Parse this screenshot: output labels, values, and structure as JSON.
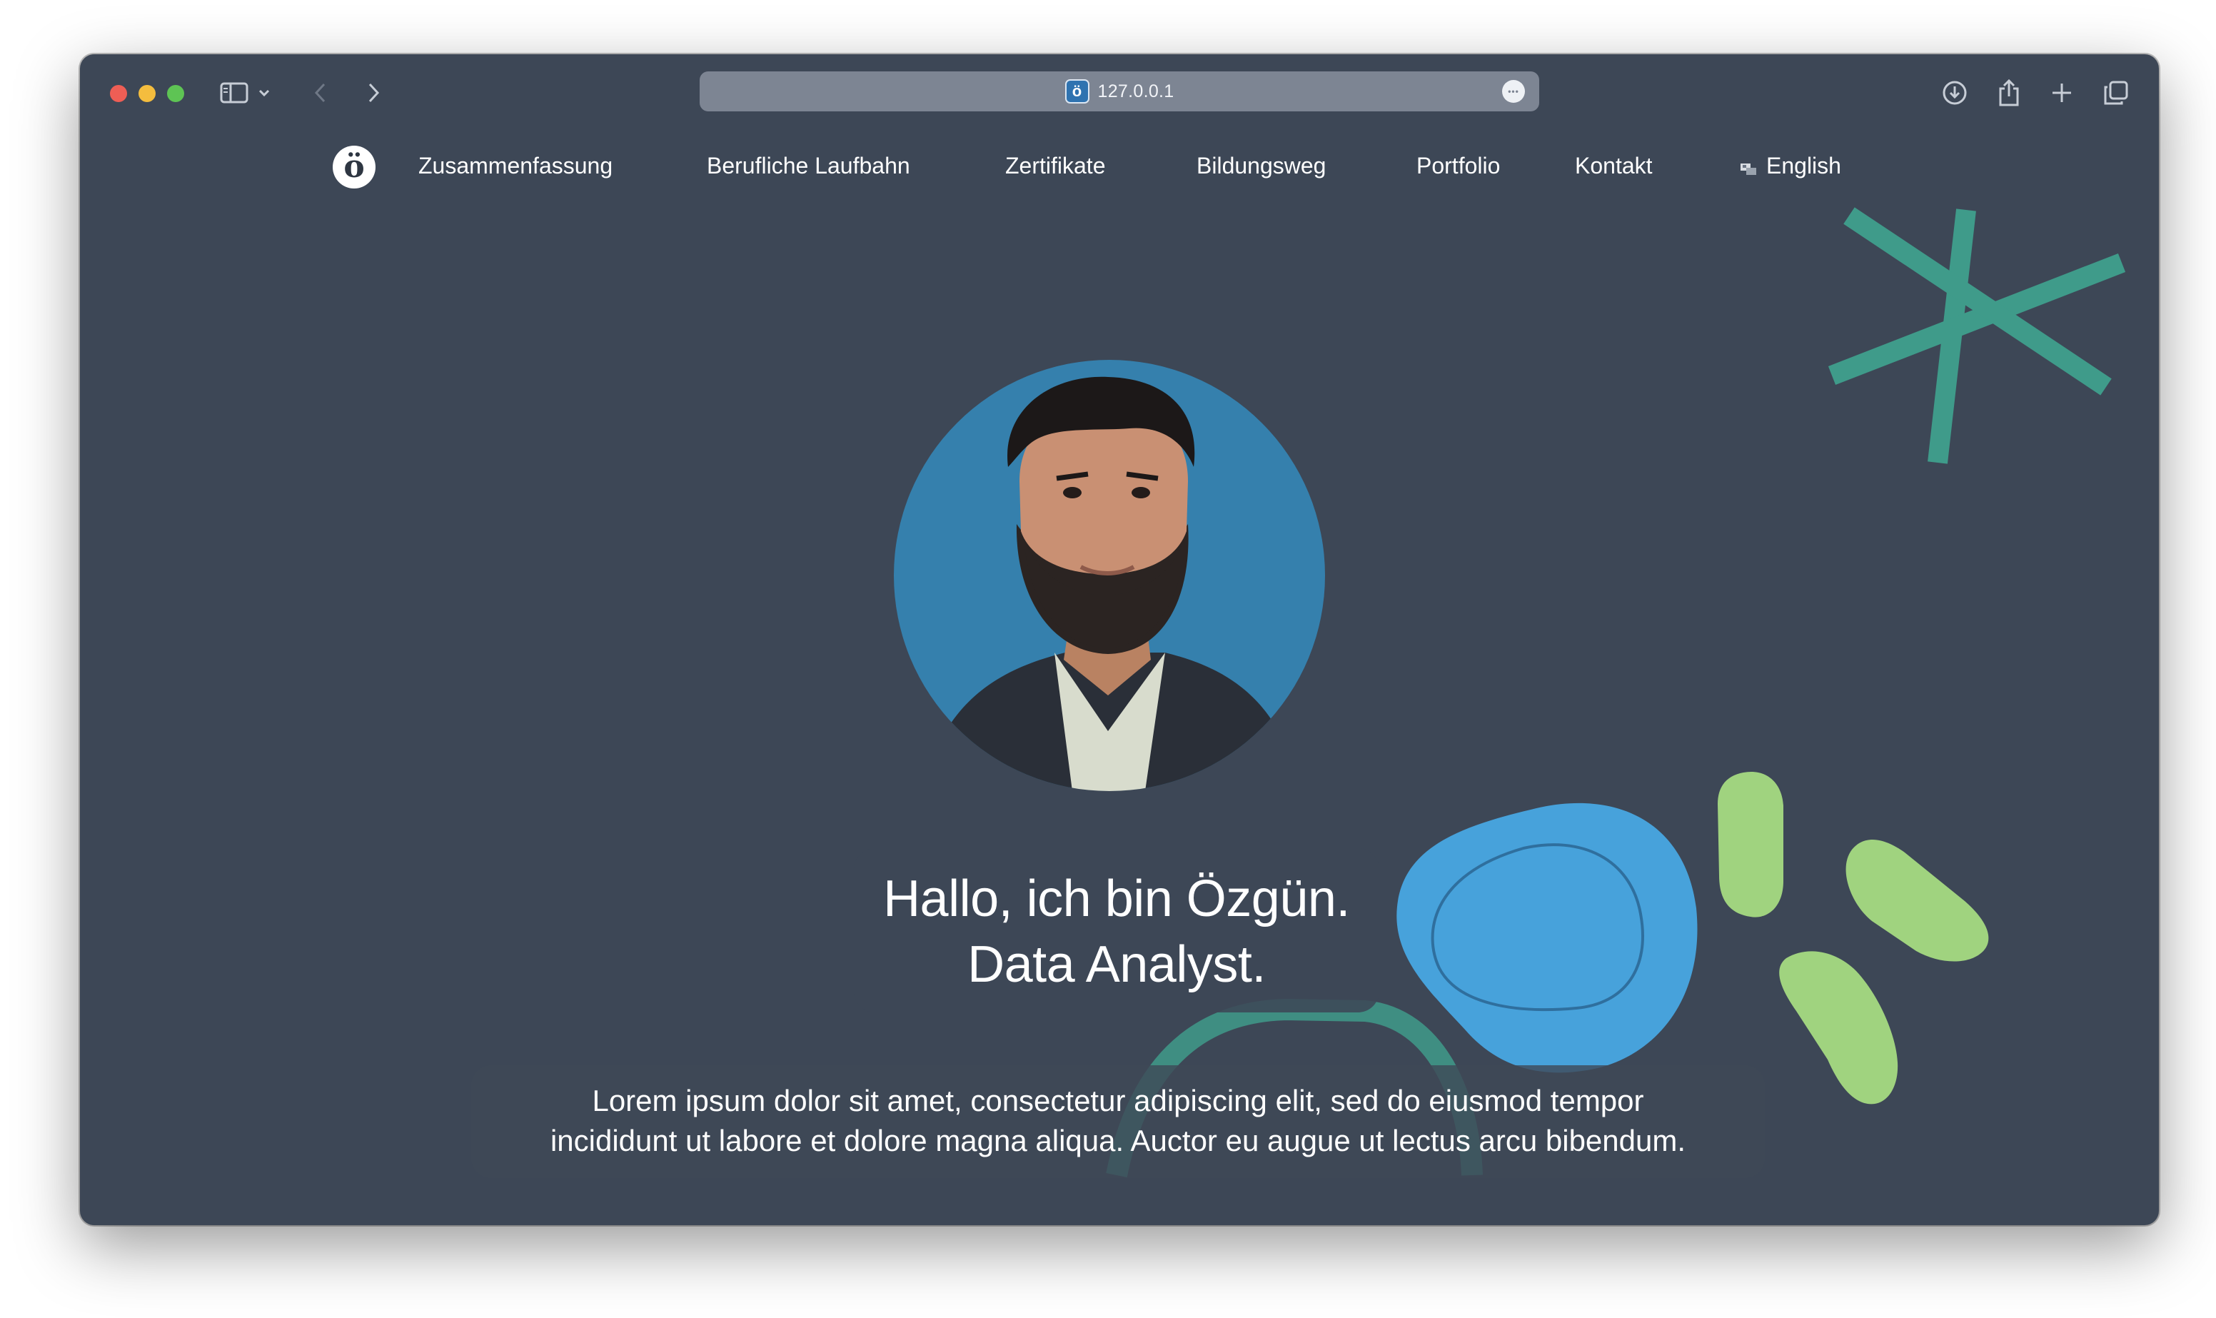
{
  "browser": {
    "url": "127.0.0.1",
    "favicon_letter": "ö",
    "more_glyph": "•••"
  },
  "nav": {
    "logo_letter": "ö",
    "items": [
      {
        "label": "Zusammenfassung"
      },
      {
        "label": "Berufliche Laufbahn"
      },
      {
        "label": "Zertifikate"
      },
      {
        "label": "Bildungsweg"
      },
      {
        "label": "Portfolio"
      },
      {
        "label": "Kontakt"
      }
    ],
    "language": "English"
  },
  "hero": {
    "title_line1": "Hallo, ich bin Özgün.",
    "title_line2": "Data Analyst.",
    "description_line1": "Lorem ipsum dolor sit amet, consectetur adipiscing elit, sed do eiusmod tempor",
    "description_line2": "incididunt ut labore et dolore magna aliqua. Auctor eu augue ut lectus arcu bibendum."
  },
  "colors": {
    "page_background": "#3d4756",
    "avatar_background": "#3580ad",
    "accent_teal": "#3f9b8a",
    "accent_blue": "#47a2db",
    "accent_green": "#a0d37f"
  }
}
